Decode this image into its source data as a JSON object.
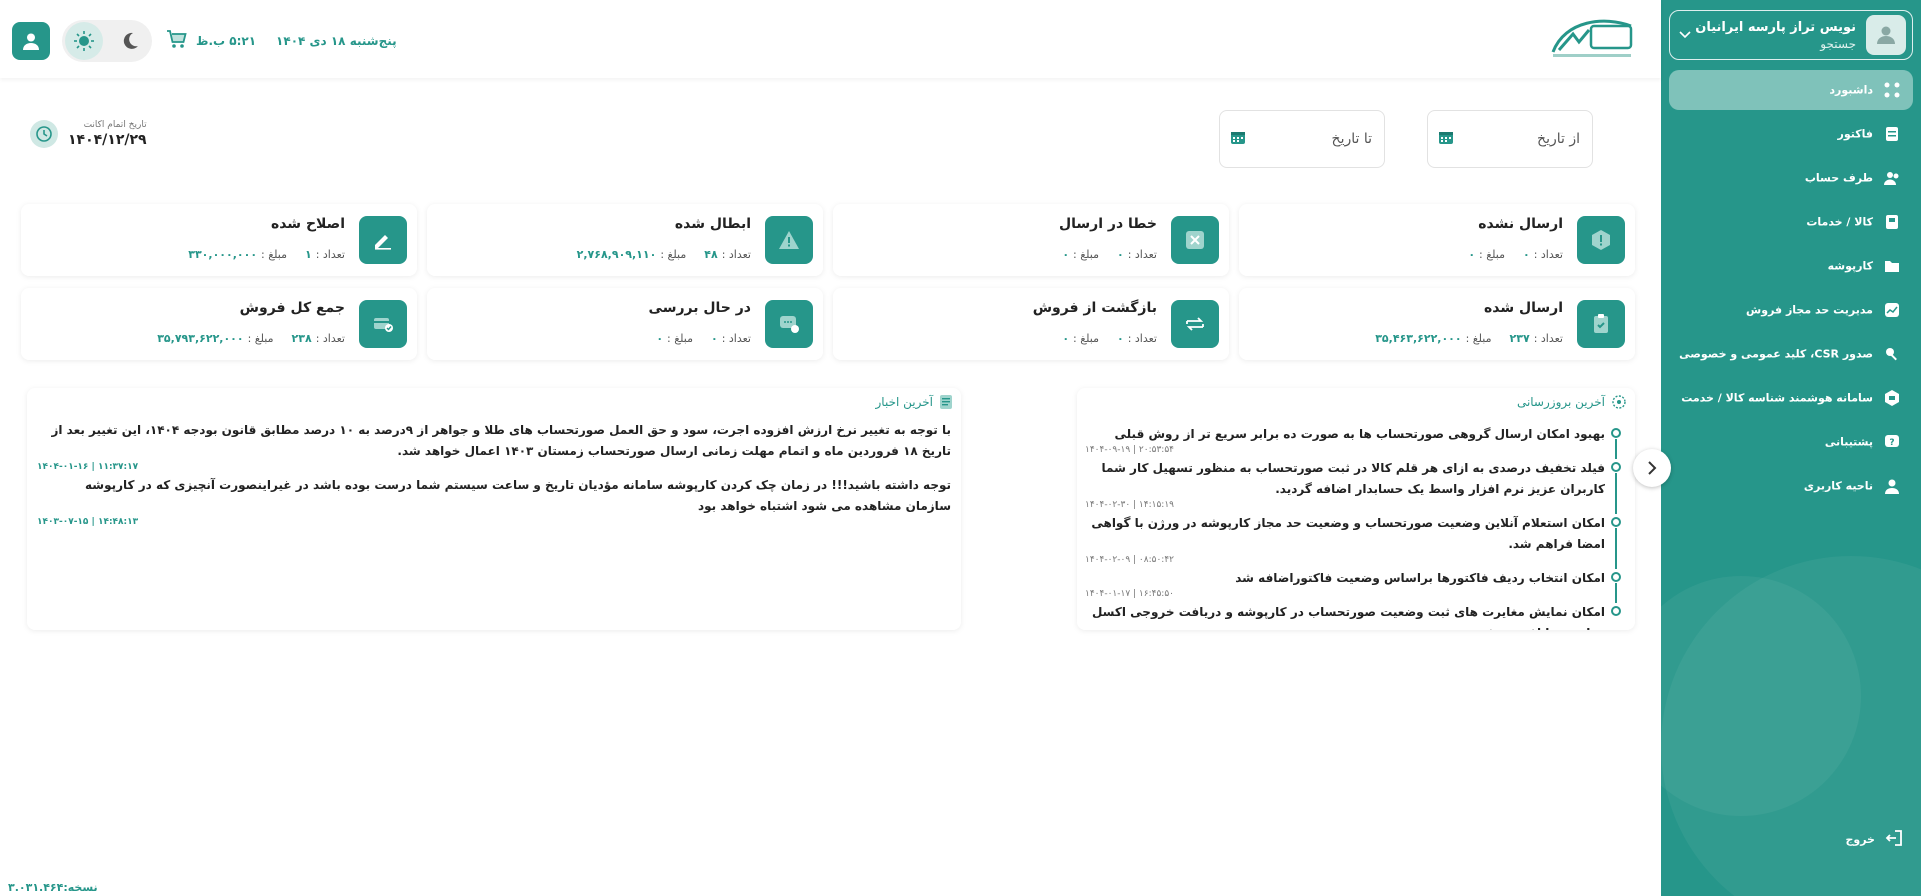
{
  "user": {
    "name": "نویس تراز پارسه ایرانیان",
    "subtitle": "جستجو"
  },
  "menu": [
    {
      "label": "داشبورد",
      "icon": "dashboard-icon",
      "active": true
    },
    {
      "label": "فاکتور",
      "icon": "invoice-icon"
    },
    {
      "label": "طرف حساب",
      "icon": "contacts-icon"
    },
    {
      "label": "کالا / خدمات",
      "icon": "goods-icon"
    },
    {
      "label": "کارپوشه",
      "icon": "folder-icon"
    },
    {
      "label": "مدیریت حد مجاز فروش",
      "icon": "chart-icon"
    },
    {
      "label": "صدور CSR، کلید عمومی و خصوصی",
      "icon": "key-icon"
    },
    {
      "label": "سامانه هوشمند شناسه کالا / خدمت",
      "icon": "barcode-icon"
    },
    {
      "label": "پشتیبانی",
      "icon": "support-icon"
    },
    {
      "label": "ناحیه کاربری",
      "icon": "user-area-icon"
    }
  ],
  "logout_label": "خروج",
  "header": {
    "date": "پنج‌شنبه ۱۸ دی ۱۴۰۴",
    "time": "۵:۲۱ ب.ظ"
  },
  "filters": {
    "from_label": "از تاریخ",
    "to_label": "تا تاریخ"
  },
  "account_expiry": {
    "label": "تاریخ اتمام اکانت",
    "value": "۱۴۰۴/۱۲/۲۹"
  },
  "labels": {
    "count": "تعداد :",
    "amount": "مبلغ :"
  },
  "stats": [
    {
      "title": "ارسال نشده",
      "count": "۰",
      "amount": "۰",
      "icon": "alert-hex-icon"
    },
    {
      "title": "خطا در ارسال",
      "count": "۰",
      "amount": "۰",
      "icon": "error-x-icon"
    },
    {
      "title": "ابطال شده",
      "count": "۴۸",
      "amount": "۲,۷۶۸,۹۰۹,۱۱۰",
      "icon": "warning-triangle-icon"
    },
    {
      "title": "اصلاح شده",
      "count": "۱",
      "amount": "۳۳۰,۰۰۰,۰۰۰",
      "icon": "edit-icon"
    },
    {
      "title": "ارسال شده",
      "count": "۲۳۷",
      "amount": "۳۵,۴۶۳,۶۲۲,۰۰۰",
      "icon": "clipboard-check-icon"
    },
    {
      "title": "بازگشت از فروش",
      "count": "۰",
      "amount": "۰",
      "icon": "return-arrows-icon"
    },
    {
      "title": "در حال بررسی",
      "count": "۰",
      "amount": "۰",
      "icon": "review-chat-icon"
    },
    {
      "title": "جمع کل فروش",
      "count": "۲۳۸",
      "amount": "۳۵,۷۹۳,۶۲۲,۰۰۰",
      "icon": "payment-cards-icon"
    }
  ],
  "updates": {
    "title": "آخرین بروزرسانی",
    "items": [
      {
        "text": "بهبود امکان ارسال گروهی صورتحساب ها به صورت ده برابر سریع تر از روش قبلی",
        "stamp": "۱۴۰۴-۰۹-۱۹ | ۲۰:۵۳:۵۴"
      },
      {
        "text": "فیلد تخفیف درصدی به ازای هر قلم کالا در ثبت صورتحساب به منظور تسهیل کار شما کاربران عزیز نرم افزار واسط یک حسابدار اضافه گردید.",
        "stamp": "۱۴۰۴-۰۲-۳۰ | ۱۴:۱۵:۱۹"
      },
      {
        "text": "امکان استعلام آنلاین وضعیت صورتحساب و وضعیت حد مجاز کارپوشه در ورژن با گواهی امضا فراهم شد.",
        "stamp": "۱۴۰۴-۰۲-۰۹ | ۰۸:۵۰:۴۲"
      },
      {
        "text": "امکان انتخاب ردیف فاکتورها براساس وضعیت فاکتوراضافه شد",
        "stamp": "۱۴۰۴-۰۱-۱۷ | ۱۶:۴۵:۵۰"
      },
      {
        "text": "امکان نمایش مغایرت های ثبت وضعیت صورتحساب در کارپوشه و دریافت خروجی اکسل مغایرت ها افزوده شد",
        "stamp": ""
      }
    ]
  },
  "news": {
    "title": "آخرین اخبار",
    "items": [
      {
        "text": "با توجه به تغییر نرخ ارزش افزوده اجرت، سود و حق العمل صورتحساب های طلا و جواهر از ۹درصد به ۱۰ درصد مطابق قانون بودجه ۱۴۰۴، این تغییر بعد از تاریخ ۱۸ فروردین ماه و اتمام مهلت زمانی ارسال صورتحساب زمستان ۱۴۰۳ اعمال خواهد شد.",
        "stamp": "۱۴۰۴-۰۱-۱۶ | ۱۱:۳۷:۱۷"
      },
      {
        "text": "توجه داشته باشید!!! در زمان چک کردن کارپوشه سامانه مؤدیان تاریخ و ساعت سیستم شما درست بوده باشد در غیراینصورت آنچیزی که در کارپوشه سازمان مشاهده می شود اشتباه خواهد بود",
        "stamp": "۱۴۰۳-۰۷-۱۵ | ۱۴:۴۸:۱۳"
      }
    ]
  },
  "version": "نسخه:۳.۰۳۱.۴۶۴",
  "colors": {
    "accent": "#26968a",
    "accent_light": "#7fc2ba"
  }
}
